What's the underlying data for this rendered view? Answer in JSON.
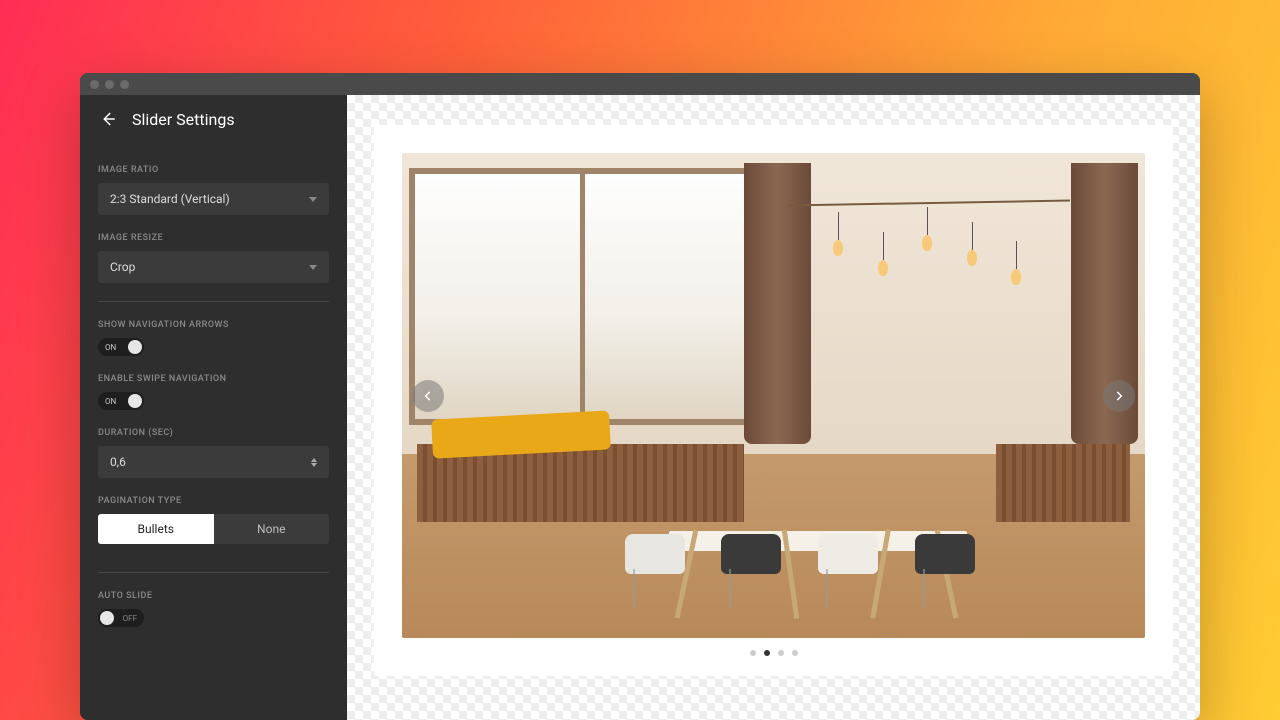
{
  "panel": {
    "title": "Slider Settings",
    "image_ratio": {
      "label": "IMAGE RATIO",
      "value": "2:3 Standard (Vertical)"
    },
    "image_resize": {
      "label": "IMAGE RESIZE",
      "value": "Crop"
    },
    "show_arrows": {
      "label": "SHOW NAVIGATION ARROWS",
      "state": "ON"
    },
    "swipe": {
      "label": "ENABLE SWIPE NAVIGATION",
      "state": "ON"
    },
    "duration": {
      "label": "DURATION (SEC)",
      "value": "0,6"
    },
    "pagination": {
      "label": "PAGINATION TYPE",
      "options": [
        "Bullets",
        "None"
      ],
      "active": "Bullets"
    },
    "auto_slide": {
      "label": "AUTO SLIDE",
      "state": "OFF"
    }
  },
  "slider": {
    "bullet_count": 4,
    "active_index": 1
  }
}
